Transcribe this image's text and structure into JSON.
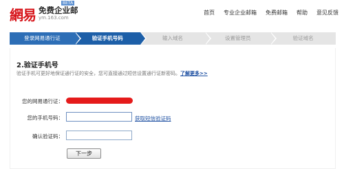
{
  "header": {
    "logo_mark": "網易",
    "brand_title": "免费企业邮",
    "beta_badge": "BETA",
    "domain": "ym.163.com",
    "nav": [
      "首页",
      "专业企业邮箱",
      "免费邮箱",
      "帮助",
      "意见反馈"
    ]
  },
  "steps": [
    {
      "label": "登录网易通行证",
      "state": "done"
    },
    {
      "label": "验证手机号码",
      "state": "current"
    },
    {
      "label": "输入域名",
      "state": "pending"
    },
    {
      "label": "设置管理员",
      "state": "pending"
    },
    {
      "label": "验证域名",
      "state": "pending"
    }
  ],
  "colors": {
    "step_done": "#2d6eb6",
    "step_current": "#1d5fa8",
    "step_pending": "#e5e5e5",
    "link": "#1e50a2",
    "logo_red": "#d7141a",
    "redaction": "#e51b1b"
  },
  "main": {
    "section_title": "2.验证手机号",
    "description": "验证手机可更好地保证通行证的安全，您可直接通过短信设置通行证新密码。",
    "learn_more": "了解更多>>"
  },
  "form": {
    "passport_label": "您的网易通行证：",
    "phone_label": "您的手机号码：",
    "phone_value": "",
    "get_code_link": "获取短信验证码",
    "code_label": "确认验证码：",
    "code_value": "",
    "next_button": "下一步"
  }
}
